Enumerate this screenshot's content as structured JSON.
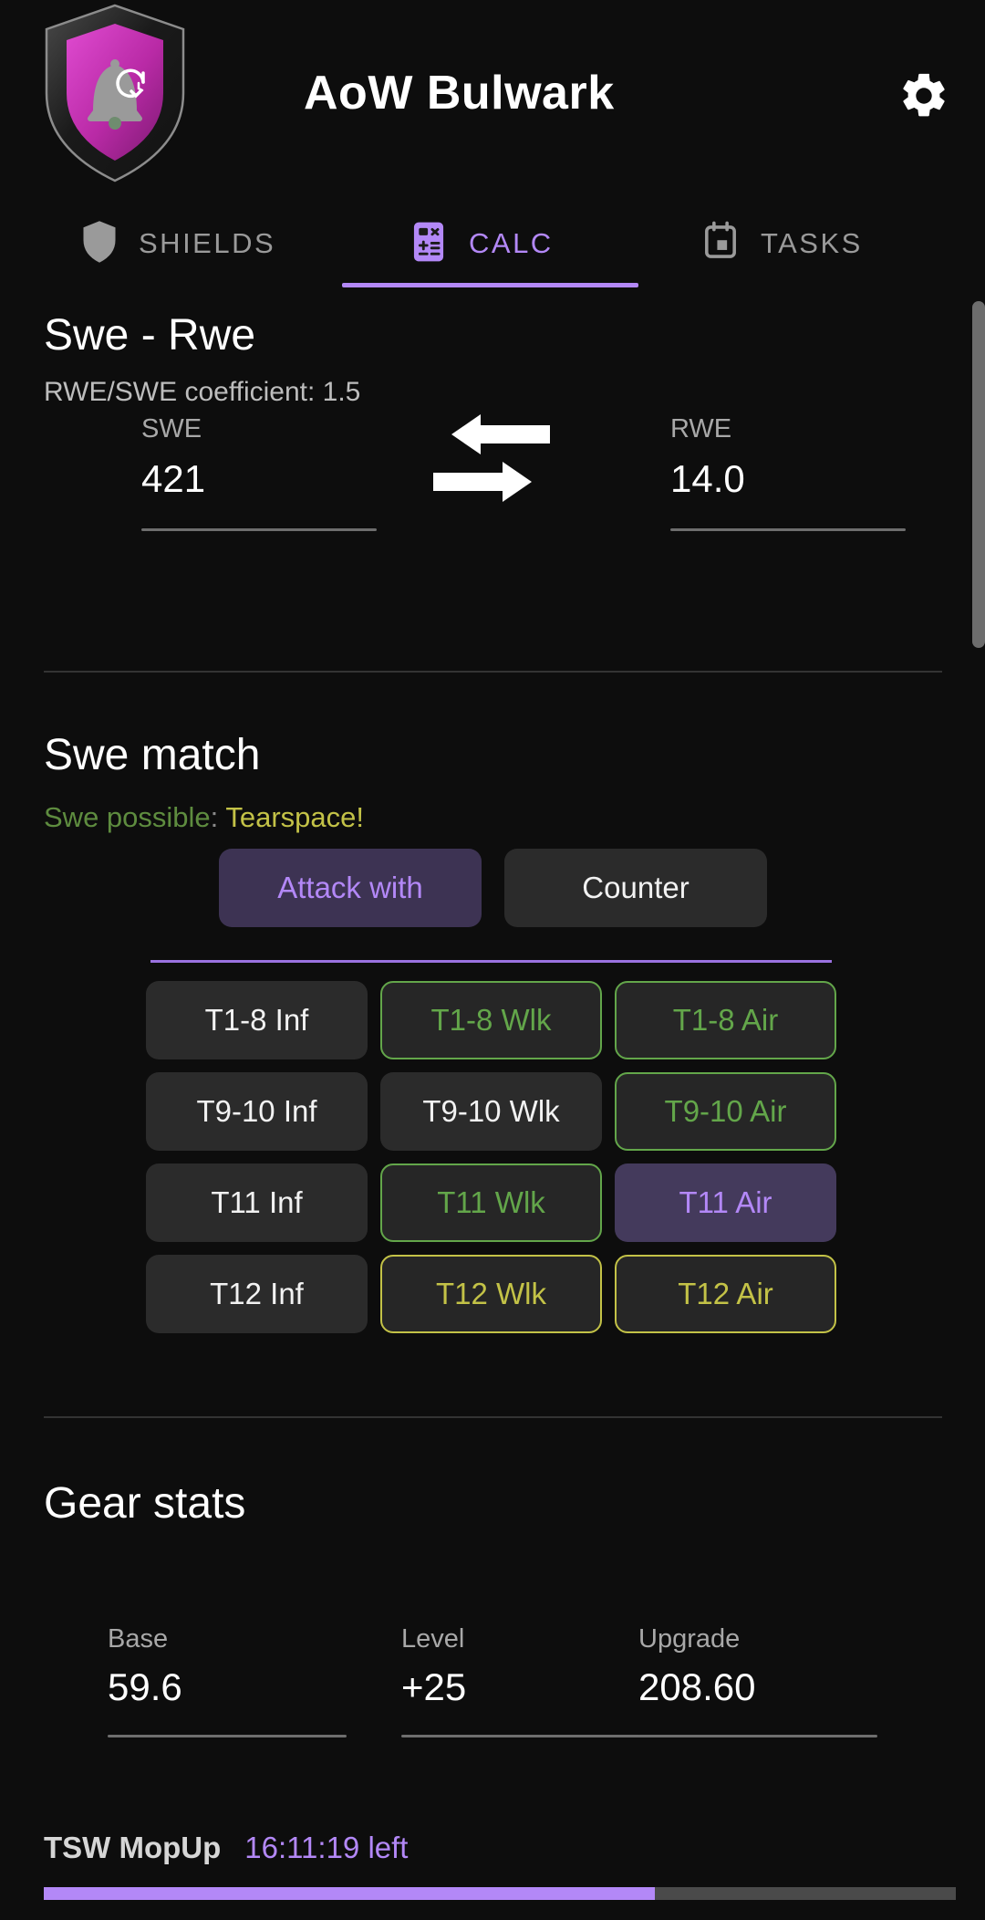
{
  "header": {
    "title": "AoW Bulwark",
    "logo_icon": "shield-bell-reminder-logo",
    "settings_icon": "gear-icon"
  },
  "tabs": [
    {
      "label": "SHIELDS",
      "icon": "shield-icon",
      "active": false
    },
    {
      "label": "CALC",
      "icon": "calculator-icon",
      "active": true
    },
    {
      "label": "TASKS",
      "icon": "calendar-icon",
      "active": false
    }
  ],
  "swe_rwe": {
    "title": "Swe - Rwe",
    "coefficient_label": "RWE/SWE coefficient: 1.5",
    "swe": {
      "label": "SWE",
      "value": "421"
    },
    "rwe": {
      "label": "RWE",
      "value": "14.0"
    },
    "swap_icon": "double-arrow-swap-icon"
  },
  "swe_match": {
    "title": "Swe match",
    "possible_text": "Swe possible",
    "separator": ":",
    "tag_text": "Tearspace!",
    "modes": [
      {
        "label": "Attack with",
        "selected": true
      },
      {
        "label": "Counter",
        "selected": false
      }
    ],
    "units": [
      {
        "label": "T1-8 Inf",
        "state": "neutral"
      },
      {
        "label": "T1-8 Wlk",
        "state": "green"
      },
      {
        "label": "T1-8 Air",
        "state": "green"
      },
      {
        "label": "T9-10 Inf",
        "state": "neutral"
      },
      {
        "label": "T9-10 Wlk",
        "state": "neutral"
      },
      {
        "label": "T9-10 Air",
        "state": "green"
      },
      {
        "label": "T11 Inf",
        "state": "neutral"
      },
      {
        "label": "T11 Wlk",
        "state": "green"
      },
      {
        "label": "T11 Air",
        "state": "purple"
      },
      {
        "label": "T12 Inf",
        "state": "neutral"
      },
      {
        "label": "T12 Wlk",
        "state": "yellow"
      },
      {
        "label": "T12 Air",
        "state": "yellow"
      }
    ]
  },
  "gear_stats": {
    "title": "Gear stats",
    "base": {
      "label": "Base",
      "value": "59.6"
    },
    "level": {
      "label": "Level",
      "value": "+25"
    },
    "upgrade": {
      "label": "Upgrade",
      "value": "208.60"
    }
  },
  "bottom_bar": {
    "name": "TSW MopUp",
    "time_left": "16:11:19 left",
    "progress_percent": 67
  },
  "colors": {
    "accent_purple": "#b388f7",
    "green": "#63a64a",
    "yellow": "#c3c247",
    "background": "#0d0d0d",
    "surface": "#2b2b2b"
  }
}
